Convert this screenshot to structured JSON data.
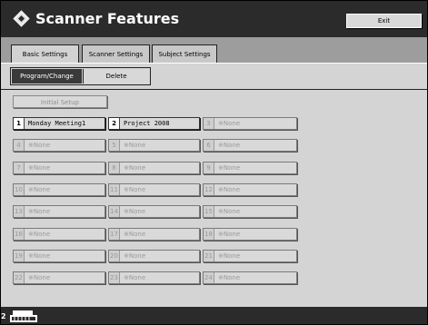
{
  "header": {
    "title": "Scanner Features",
    "exit_label": "Exit"
  },
  "tabs": [
    {
      "label": "Basic Settings",
      "active": true
    },
    {
      "label": "Scanner Settings",
      "active": false
    },
    {
      "label": "Subject Settings",
      "active": false
    }
  ],
  "mode": {
    "program_label": "Program/Change",
    "delete_label": "Delete",
    "selected": "Program/Change"
  },
  "initial_setup_label": "Initial Setup",
  "slots": [
    {
      "num": "1",
      "name": "Monday Meeting1",
      "filled": true
    },
    {
      "num": "2",
      "name": "Project 2008",
      "filled": true
    },
    {
      "num": "3",
      "name": "※None",
      "filled": false
    },
    {
      "num": "4",
      "name": "※None",
      "filled": false
    },
    {
      "num": "5",
      "name": "※None",
      "filled": false
    },
    {
      "num": "6",
      "name": "※None",
      "filled": false
    },
    {
      "num": "7",
      "name": "※None",
      "filled": false
    },
    {
      "num": "8",
      "name": "※None",
      "filled": false
    },
    {
      "num": "9",
      "name": "※None",
      "filled": false
    },
    {
      "num": "10",
      "name": "※None",
      "filled": false
    },
    {
      "num": "11",
      "name": "※None",
      "filled": false
    },
    {
      "num": "12",
      "name": "※None",
      "filled": false
    },
    {
      "num": "13",
      "name": "※None",
      "filled": false
    },
    {
      "num": "14",
      "name": "※None",
      "filled": false
    },
    {
      "num": "15",
      "name": "※None",
      "filled": false
    },
    {
      "num": "16",
      "name": "※None",
      "filled": false
    },
    {
      "num": "17",
      "name": "※None",
      "filled": false
    },
    {
      "num": "18",
      "name": "※None",
      "filled": false
    },
    {
      "num": "19",
      "name": "※None",
      "filled": false
    },
    {
      "num": "20",
      "name": "※None",
      "filled": false
    },
    {
      "num": "21",
      "name": "※None",
      "filled": false
    },
    {
      "num": "22",
      "name": "※None",
      "filled": false
    },
    {
      "num": "23",
      "name": "※None",
      "filled": false
    },
    {
      "num": "24",
      "name": "※None",
      "filled": false
    }
  ],
  "footer": {
    "indicator": "2",
    "icon": "scanner-status-icon"
  }
}
